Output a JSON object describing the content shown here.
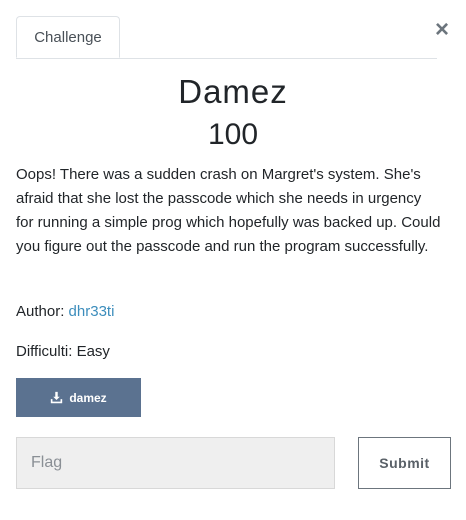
{
  "tabs": [
    {
      "label": "Challenge"
    }
  ],
  "close_label": "×",
  "challenge": {
    "name": "Damez",
    "value": "100",
    "description": "Oops! There was a sudden crash on Margret's system. She's afraid that she lost the passcode which she needs in urgency for running a simple prog which hopefully was backed up. Could you figure out the passcode and run the program successfully.",
    "author_label": "Author:",
    "author": "dhr33ti",
    "difficulty_label": "Difficulti:",
    "difficulty": "Easy"
  },
  "files": [
    {
      "label": "damez",
      "icon": "download-icon"
    }
  ],
  "flag_form": {
    "placeholder": "Flag",
    "value": "",
    "submit_label": "Submit"
  }
}
